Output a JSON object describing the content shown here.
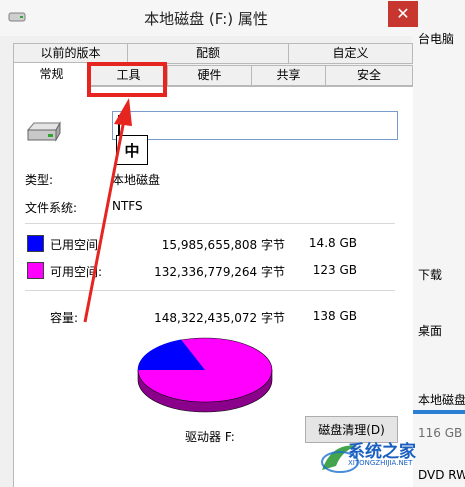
{
  "dialog": {
    "title": "本地磁盘 (F:) 属性",
    "close_glyph": "✕"
  },
  "tabs_row1": [
    {
      "label": "以前的版本"
    },
    {
      "label": "配额"
    },
    {
      "label": "自定义"
    }
  ],
  "tabs_row2": [
    {
      "label": "常规",
      "active": true
    },
    {
      "label": "工具"
    },
    {
      "label": "硬件"
    },
    {
      "label": "共享"
    },
    {
      "label": "安全"
    }
  ],
  "general": {
    "name_value": "",
    "ime_indicator": "中",
    "type_label": "类型:",
    "type_value": "本地磁盘",
    "fs_label": "文件系统:",
    "fs_value": "NTFS",
    "used": {
      "label": "已用空间:",
      "bytes": "15,985,655,808 字节",
      "size": "14.8 GB",
      "color": "#0000ff"
    },
    "free": {
      "label": "可用空间:",
      "bytes": "132,336,779,264 字节",
      "size": "123 GB",
      "color": "#ff00ff"
    },
    "capacity": {
      "label": "容量:",
      "bytes": "148,322,435,072 字节",
      "size": "138 GB"
    },
    "drive_label": "驱动器 F:",
    "cleanup_button": "磁盘清理(D)"
  },
  "background_window": {
    "lines": [
      "台电脑",
      "下载",
      "桌面",
      "本地磁盘",
      "116 GB",
      "DVD RW"
    ]
  },
  "watermark": {
    "name": "系统之家",
    "site": "XITONGZHIJIA.NET"
  },
  "colors": {
    "highlight": "#e62520",
    "used": "#0000ff",
    "free": "#ff00ff"
  },
  "icons": [
    "drive-icon",
    "close-icon",
    "app-icon"
  ]
}
